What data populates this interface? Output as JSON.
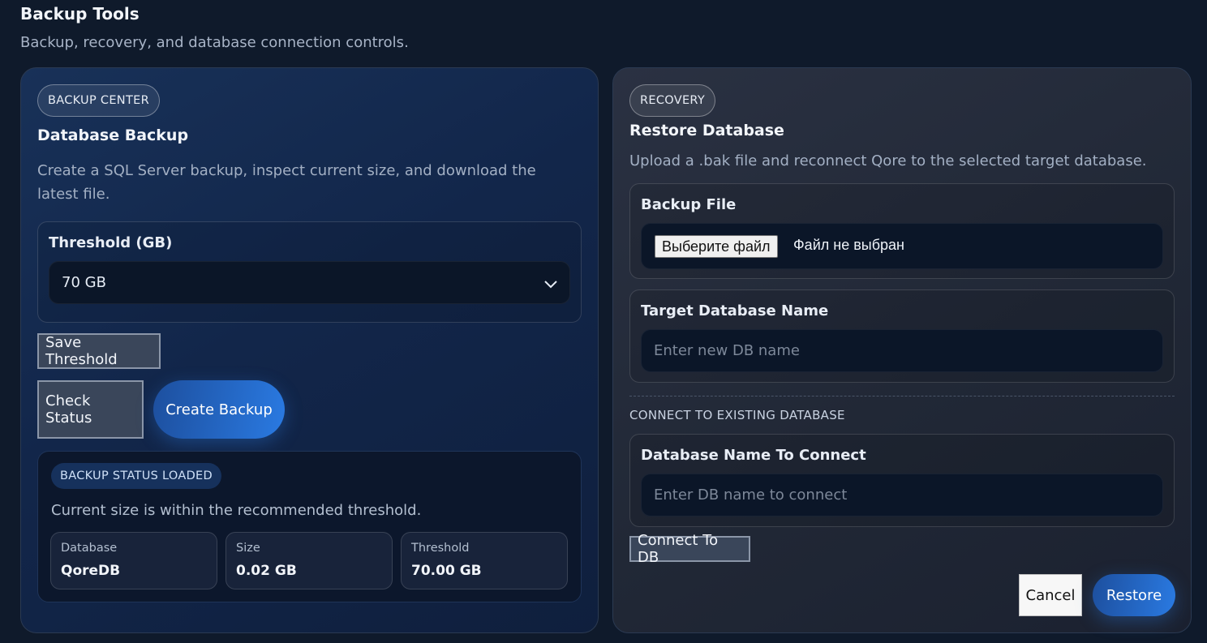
{
  "header": {
    "title": "Backup Tools",
    "subtitle": "Backup, recovery, and database connection controls."
  },
  "backup": {
    "badge": "BACKUP CENTER",
    "title": "Database Backup",
    "description": "Create a SQL Server backup, inspect current size, and download the latest file.",
    "threshold_label": "Threshold (GB)",
    "threshold_value": "70 GB",
    "save_threshold_label": "Save Threshold",
    "check_status_label": "Check Status",
    "create_backup_label": "Create Backup",
    "status": {
      "badge": "BACKUP STATUS LOADED",
      "message": "Current size is within the recommended threshold.",
      "stats": [
        {
          "label": "Database",
          "value": "QoreDB"
        },
        {
          "label": "Size",
          "value": "0.02 GB"
        },
        {
          "label": "Threshold",
          "value": "70.00 GB"
        }
      ]
    }
  },
  "recovery": {
    "badge": "RECOVERY",
    "title": "Restore Database",
    "description": "Upload a .bak file and reconnect Qore to the selected target database.",
    "backup_file_label": "Backup File",
    "file_button_label": "Выберите файл",
    "file_status": "Файл не выбран",
    "target_db_label": "Target Database Name",
    "target_db_placeholder": "Enter new DB name",
    "connect_section_heading": "CONNECT TO EXISTING DATABASE",
    "connect_db_label": "Database Name To Connect",
    "connect_db_placeholder": "Enter DB name to connect",
    "connect_button_label": "Connect To DB",
    "cancel_label": "Cancel",
    "restore_label": "Restore"
  },
  "colors": {
    "accent": "#2a7ae2",
    "background": "#0f1a2b"
  },
  "icons": {
    "select_chevron": "chevron-down-icon"
  }
}
